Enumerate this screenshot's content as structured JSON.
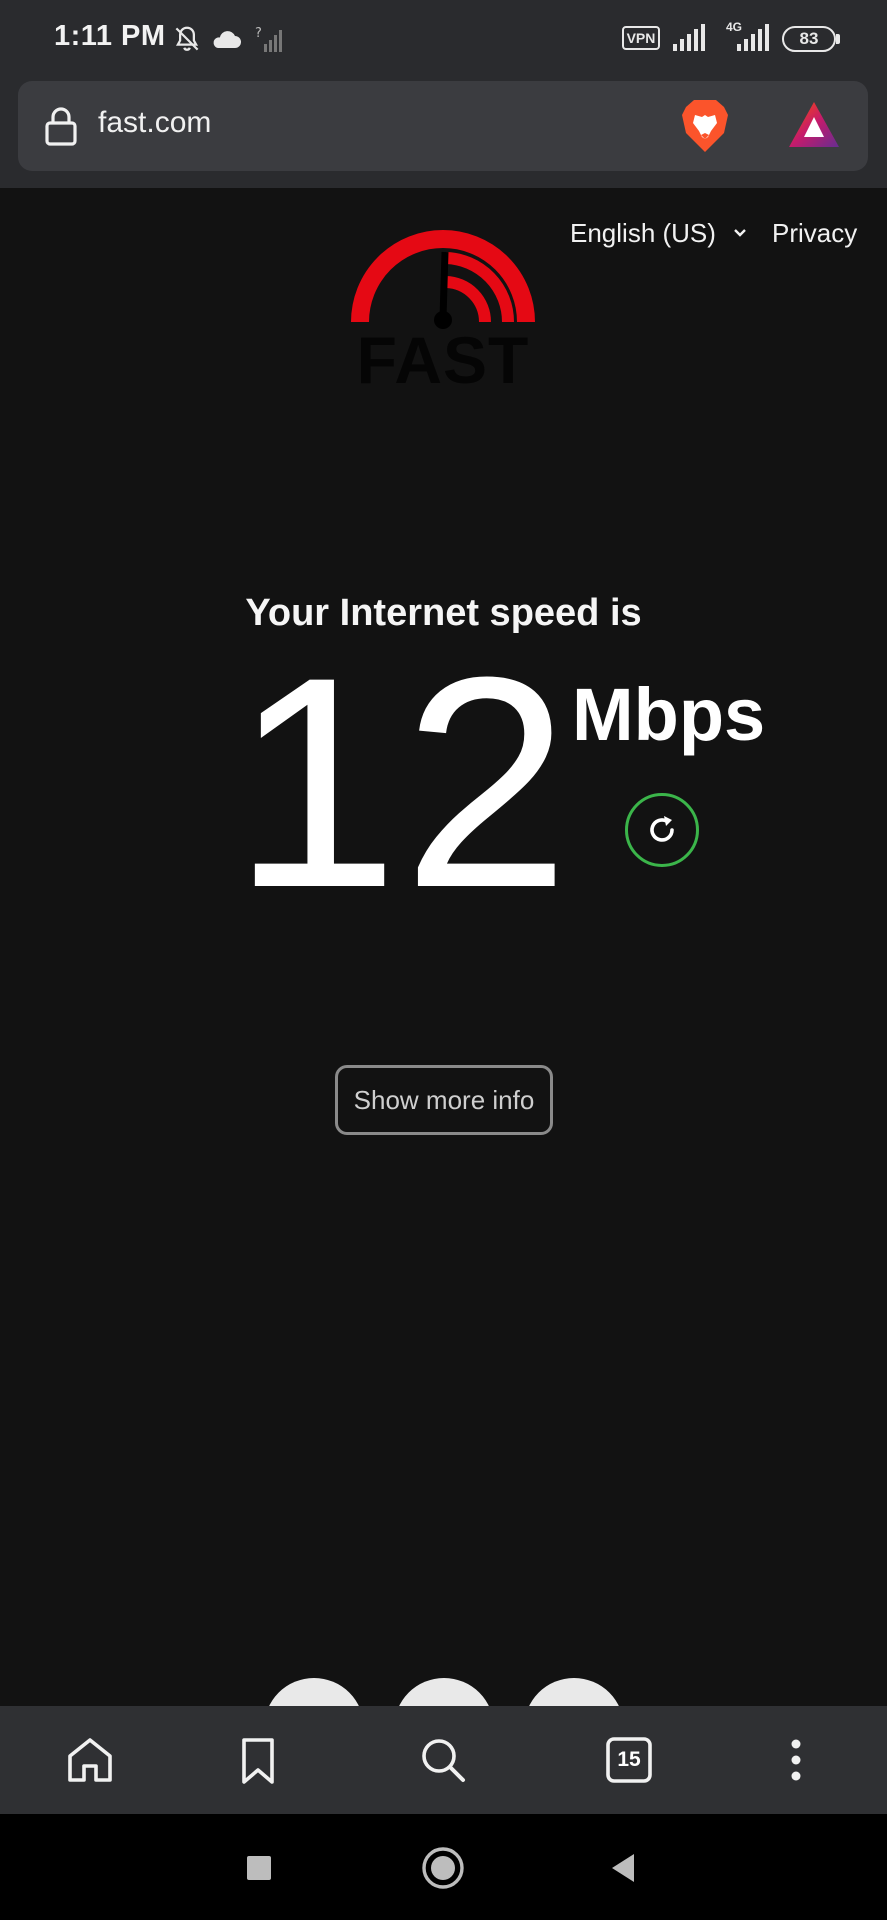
{
  "status_bar": {
    "time": "1:11 PM",
    "vpn_label": "VPN",
    "network_type": "4G",
    "battery_level": "83"
  },
  "browser": {
    "url": "fast.com",
    "tab_count": "15"
  },
  "page": {
    "language": "English (US)",
    "privacy_label": "Privacy",
    "logo_text": "FAST",
    "speed_caption": "Your Internet speed is",
    "speed_value": "12",
    "speed_unit": "Mbps",
    "more_info_label": "Show more info"
  },
  "colors": {
    "logo_red": "#e50914",
    "refresh_green": "#3bb54a",
    "background": "#121212"
  },
  "icons": {
    "status": [
      "mute-bell-icon",
      "cloud-icon",
      "no-signal-icon",
      "vpn-icon",
      "signal-icon",
      "battery-icon"
    ],
    "url_bar": [
      "lock-icon",
      "brave-shields-icon",
      "brave-rewards-icon"
    ],
    "toolbar": [
      "home-icon",
      "bookmark-icon",
      "search-icon",
      "tabs-icon",
      "more-menu-icon"
    ],
    "nav": [
      "recents-icon",
      "home-nav-icon",
      "back-icon"
    ]
  }
}
